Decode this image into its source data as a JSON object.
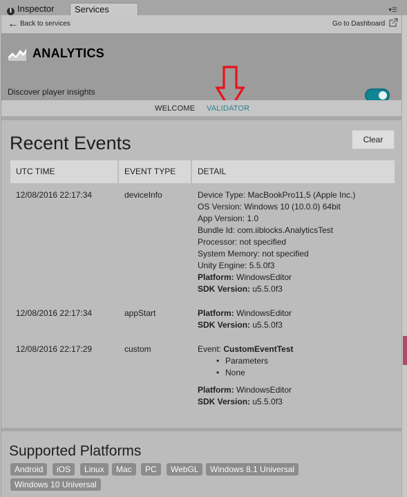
{
  "tabs": [
    {
      "label": "Inspector",
      "icon": "info-icon"
    },
    {
      "label": "Services"
    }
  ],
  "topbar": {
    "back_label": "Back to services",
    "dashboard_label": "Go to Dashboard"
  },
  "header": {
    "title": "ANALYTICS",
    "subtitle": "Discover player insights",
    "toggle_on": true
  },
  "subtabs": [
    "WELCOME",
    "VALIDATOR"
  ],
  "recent": {
    "title": "Recent Events",
    "clear_label": "Clear",
    "columns": [
      "UTC TIME",
      "EVENT TYPE",
      "DETAIL"
    ],
    "rows": [
      {
        "time": "12/08/2016 22:17:34",
        "type": "deviceInfo",
        "details": [
          {
            "key": "",
            "value": "Device Type: MacBookPro11,5 (Apple Inc.)"
          },
          {
            "key": "",
            "value": "OS Version: Windows 10 (10.0.0) 64bit"
          },
          {
            "key": "",
            "value": "App Version: 1.0"
          },
          {
            "key": "",
            "value": "Bundle Id: com.iiblocks.AnalyticsTest"
          },
          {
            "key": "",
            "value": "Processor: not specified"
          },
          {
            "key": "",
            "value": "System Memory: not specified"
          },
          {
            "key": "",
            "value": "Unity Engine: 5.5.0f3"
          },
          {
            "key": "Platform:",
            "value": " WindowsEditor"
          },
          {
            "key": "SDK Version:",
            "value": " u5.5.0f3"
          }
        ]
      },
      {
        "time": "12/08/2016 22:17:34",
        "type": "appStart",
        "details": [
          {
            "key": "Platform:",
            "value": " WindowsEditor"
          },
          {
            "key": "SDK Version:",
            "value": " u5.5.0f3"
          }
        ]
      },
      {
        "time": "12/08/2016 22:17:29",
        "type": "custom",
        "event_prefix": "Event: ",
        "event_name": "CustomEventTest",
        "bullets": [
          "Parameters",
          "None"
        ],
        "details": [
          {
            "key": "Platform:",
            "value": " WindowsEditor"
          },
          {
            "key": "SDK Version:",
            "value": " u5.5.0f3"
          }
        ]
      }
    ]
  },
  "platforms": {
    "title": "Supported Platforms",
    "items": [
      "Android",
      "iOS",
      "Linux",
      "Mac",
      "PC",
      "WebGL",
      "Windows 8.1 Universal",
      "Windows 10 Universal"
    ]
  },
  "colors": {
    "accent": "#27818f",
    "toggle": "#128494",
    "annotation_arrow": "#e8131a",
    "scroll_thumb": "#b04a69"
  }
}
